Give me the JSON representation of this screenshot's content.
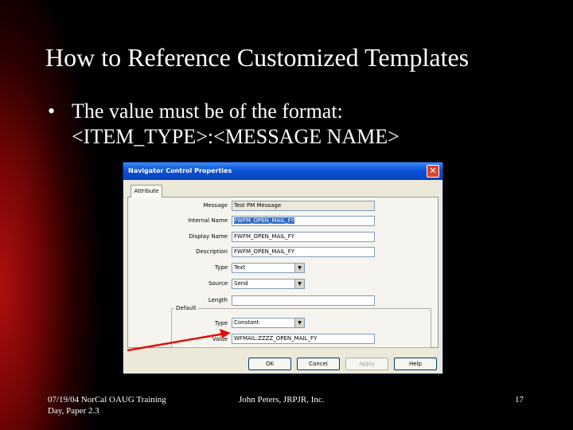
{
  "slide": {
    "title": "How to Reference Customized Templates",
    "bullet_symbol": "•",
    "bullet_line1": "The value must be of the format:",
    "bullet_line2": "<ITEM_TYPE>:<MESSAGE NAME>"
  },
  "dialog": {
    "title": "Navigator Control Properties",
    "close_symbol": "✕",
    "tab_label": "Attribute",
    "fields": {
      "message_label": "Message",
      "message_value": "Test PM Message",
      "internal_name_label": "Internal Name",
      "internal_name_value": "FWFM_OPEN_MAIL_FY",
      "display_name_label": "Display Name",
      "display_name_value": "FWFM_OPEN_MAIL_FY",
      "description_label": "Description",
      "description_value": "FWFM_OPEN_MAIL_FY",
      "type_label": "Type",
      "type_value": "Text",
      "source_label": "Source",
      "source_value": "Send",
      "length_label": "Length",
      "length_value": "",
      "default_group_label": "Default",
      "default_type_label": "Type",
      "default_type_value": "Constant",
      "value_label": "Value",
      "value_value": "WFMAIL:ZZZZ_OPEN_MAIL_FY"
    },
    "buttons": {
      "ok": "OK",
      "cancel": "Cancel",
      "apply": "Apply",
      "help": "Help"
    },
    "arrow_icon": "red-pointer-arrow",
    "arrow_color": "#e01010"
  },
  "footer": {
    "left_line1": "07/19/04 NorCal OAUG Training",
    "left_line2": "Day, Paper 2.3",
    "center": "John Peters, JRPJR, Inc.",
    "page_number": "17"
  }
}
